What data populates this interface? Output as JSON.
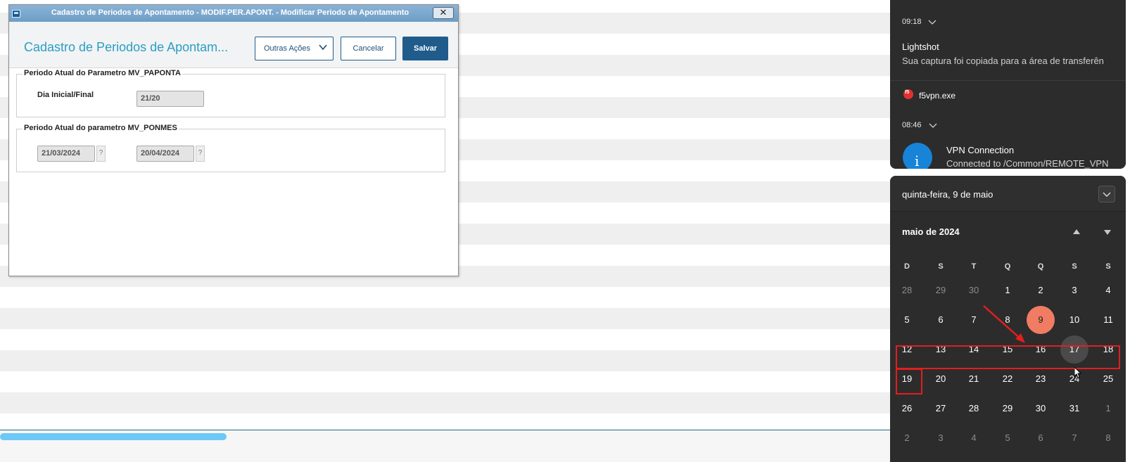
{
  "dialog": {
    "window_title": "Cadastro de Periodos de Apontamento - MODIF.PER.APONT. - Modificar Periodo de Apontamento",
    "close_glyph": "✕",
    "heading": "Cadastro de Periodos de Apontam...",
    "actions": {
      "other_label": "Outras Ações",
      "cancel_label": "Cancelar",
      "save_label": "Salvar"
    },
    "group1": {
      "legend": "Periodo Atual do Parametro MV_PAPONTA",
      "label": "Dia Inicial/Final",
      "value": "21/20"
    },
    "group2": {
      "legend": "Periodo Atual do parametro MV_PONMES",
      "start": "21/03/2024",
      "end": "20/04/2024",
      "help": "?"
    }
  },
  "notifications": [
    {
      "time": "09:18",
      "app": "Lightshot",
      "body": "Sua captura foi copiada para a área de transferên"
    },
    {
      "app": "f5vpn.exe",
      "time": "08:46",
      "title": "VPN Connection",
      "body": "Connected to /Common/REMOTE_VPN"
    }
  ],
  "calendar": {
    "date_header": "quinta-feira, 9 de maio",
    "month_label": "maio de 2024",
    "weekdays": [
      "D",
      "S",
      "T",
      "Q",
      "Q",
      "S",
      "S"
    ],
    "weeks": [
      [
        "28",
        "29",
        "30",
        "1",
        "2",
        "3",
        "4"
      ],
      [
        "5",
        "6",
        "7",
        "8",
        "9",
        "10",
        "11"
      ],
      [
        "12",
        "13",
        "14",
        "15",
        "16",
        "17",
        "18"
      ],
      [
        "19",
        "20",
        "21",
        "22",
        "23",
        "24",
        "25"
      ],
      [
        "26",
        "27",
        "28",
        "29",
        "30",
        "31",
        "1"
      ],
      [
        "2",
        "3",
        "4",
        "5",
        "6",
        "7",
        "8"
      ]
    ],
    "today": "9",
    "hovered": "17",
    "today_color": "#f07c63",
    "annotation_color": "#e31e1e"
  },
  "colors": {
    "brand": "#1f5c8b",
    "title": "#2b9ec4",
    "scrollbar": "#6ec8f5"
  }
}
